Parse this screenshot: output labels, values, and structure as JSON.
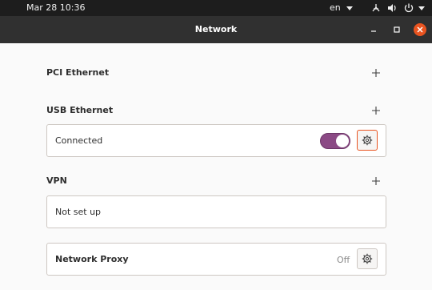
{
  "topbar": {
    "datetime": "Mar 28  10:36",
    "language": "en",
    "icons": [
      "network-icon",
      "volume-icon",
      "power-icon"
    ]
  },
  "window": {
    "title": "Network",
    "controls": [
      "minimize-icon",
      "maximize-icon",
      "close-icon"
    ]
  },
  "sections": {
    "pci": {
      "label": "PCI Ethernet"
    },
    "usb": {
      "label": "USB Ethernet",
      "status": "Connected",
      "enabled": true
    },
    "vpn": {
      "label": "VPN",
      "status": "Not set up"
    },
    "proxy": {
      "label": "Network Proxy",
      "status": "Off"
    }
  },
  "colors": {
    "accent": "#e95420",
    "switch_on": "#8b4a85",
    "header": "#303030",
    "topbar": "#1d1d1d"
  }
}
